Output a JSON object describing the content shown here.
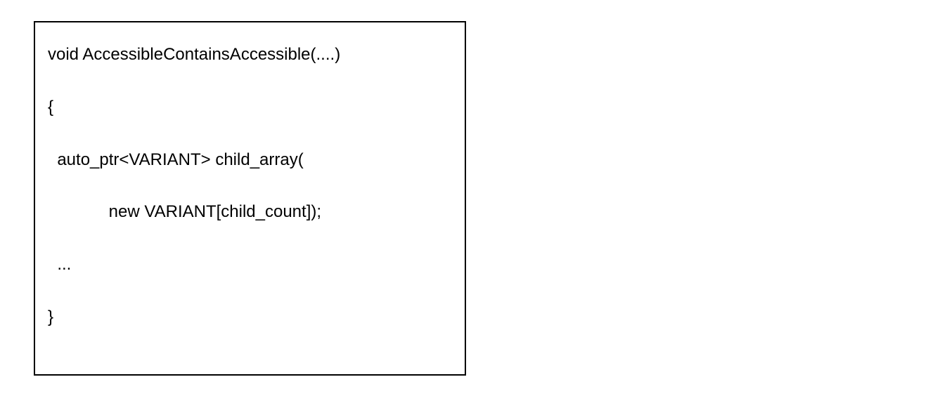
{
  "code": {
    "line1": "void AccessibleContainsAccessible(....)",
    "line2": "{",
    "line3": "  auto_ptr<VARIANT> child_array(",
    "line4": "             new VARIANT[child_count]);",
    "line5": "  ...",
    "line6": "}"
  }
}
